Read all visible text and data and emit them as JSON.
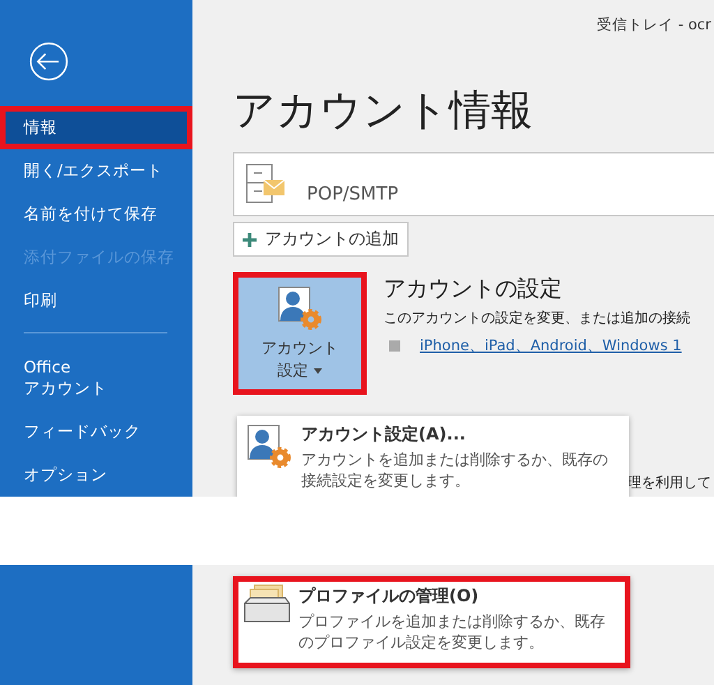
{
  "window": {
    "title": "受信トレイ - ocr"
  },
  "sidebar": {
    "items": [
      {
        "label": "情報",
        "selected": true,
        "disabled": false,
        "highlighted": true
      },
      {
        "label": "開く/エクスポート",
        "selected": false,
        "disabled": false,
        "highlighted": false
      },
      {
        "label": "名前を付けて保存",
        "selected": false,
        "disabled": false,
        "highlighted": false
      },
      {
        "label": "添付ファイルの保存",
        "selected": false,
        "disabled": true,
        "highlighted": false
      },
      {
        "label": "印刷",
        "selected": false,
        "disabled": false,
        "highlighted": false
      },
      {
        "label": "Office\nアカウント",
        "selected": false,
        "disabled": false,
        "highlighted": false
      },
      {
        "label": "フィードバック",
        "selected": false,
        "disabled": false,
        "highlighted": false
      },
      {
        "label": "オプション",
        "selected": false,
        "disabled": false,
        "highlighted": false
      }
    ]
  },
  "page": {
    "heading": "アカウント情報"
  },
  "account": {
    "type": "POP/SMTP"
  },
  "add_account_button": {
    "label": "アカウントの追加"
  },
  "account_settings": {
    "button_label_lines": [
      "アカウント",
      "設定"
    ],
    "highlighted": true,
    "heading": "アカウントの設定",
    "description": "このアカウントの設定を変更、または追加の接続",
    "link": "iPhone、iPad、Android、Windows 1"
  },
  "background_text": "理を利用して",
  "menu": {
    "items": [
      {
        "kind": "settings",
        "title": "アカウント設定(A)...",
        "description": "アカウントを追加または削除するか、既存の接続設定を変更します。",
        "highlighted": false
      },
      {
        "kind": "profile",
        "title": "プロファイルの管理(O)",
        "description": "プロファイルを追加または削除するか、既存のプロファイル設定を変更します。",
        "highlighted": true
      }
    ]
  }
}
